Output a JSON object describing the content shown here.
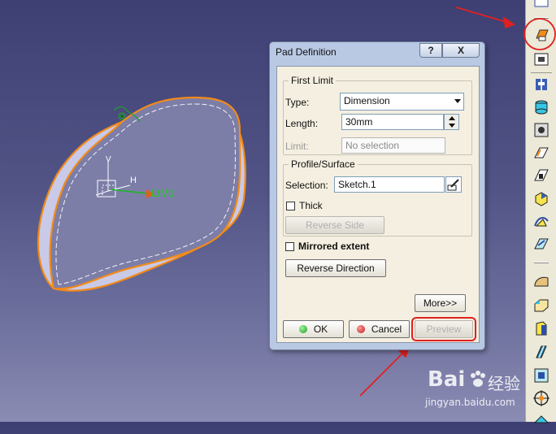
{
  "dialog": {
    "title": "Pad Definition",
    "help_label": "?",
    "close_label": "X",
    "first_limit": {
      "legend": "First Limit",
      "type_label": "Type:",
      "type_value": "Dimension",
      "length_label": "Length:",
      "length_value": "30mm",
      "limit_label": "Limit:",
      "limit_value": "No selection"
    },
    "profile": {
      "legend": "Profile/Surface",
      "selection_label": "Selection:",
      "selection_value": "Sketch.1",
      "thick_label": "Thick",
      "reverse_side_label": "Reverse Side"
    },
    "mirrored_label": "Mirrored extent",
    "reverse_direction_label": "Reverse Direction",
    "more_label": "More>>",
    "ok_label": "OK",
    "cancel_label": "Cancel",
    "preview_label": "Preview"
  },
  "viewport": {
    "limit_label": "LIM1",
    "axis_h_label": "H",
    "axis_v_label": "V"
  },
  "watermark": {
    "brand": "Bai",
    "brand_suffix": "经验",
    "url": "jingyan.baidu.com"
  },
  "colors": {
    "accent_orange": "#f28a1a",
    "annotation_red": "#e02020",
    "limit_green": "#22cc22",
    "part_face": "#7c7ea8"
  }
}
